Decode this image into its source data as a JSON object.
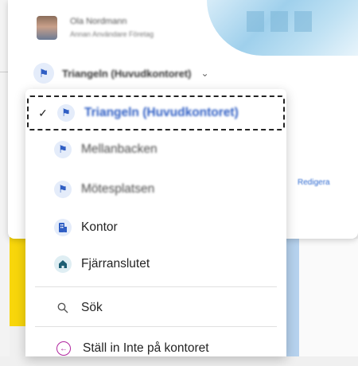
{
  "profile": {
    "name": "Ola Nordmann",
    "subtitle": "Annan Användare Företag",
    "avatar_icon": "user-avatar"
  },
  "location": {
    "current": "Triangeln (Huvudkontoret)",
    "icon": "building-pin-icon"
  },
  "side_link": "Redigera",
  "menu": {
    "items": [
      {
        "label": "Triangeln (Huvudkontoret)",
        "icon": "building-pin-icon",
        "selected": true
      },
      {
        "label": "Mellanbacken",
        "icon": "building-pin-icon"
      },
      {
        "label": "Mötesplatsen",
        "icon": "building-pin-icon"
      },
      {
        "label": "Kontor",
        "icon": "office-building-icon"
      },
      {
        "label": "Fjärranslutet",
        "icon": "home-icon"
      },
      {
        "label": "Sök",
        "icon": "search-icon"
      },
      {
        "label": "Ställ in Inte på kontoret",
        "icon": "away-arrow-icon"
      }
    ]
  },
  "colors": {
    "accent": "#2f5ec4",
    "away": "#b0259e",
    "home": "#1d5e73"
  }
}
